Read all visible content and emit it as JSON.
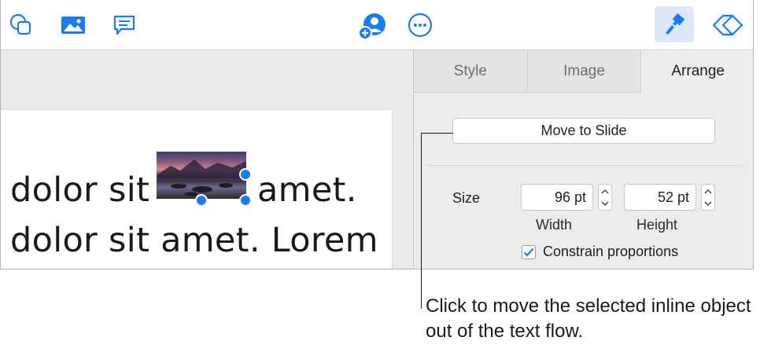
{
  "toolbar": {
    "icons": [
      "shape-icon",
      "media-icon",
      "comment-icon",
      "collaborate-icon",
      "more-icon",
      "format-icon",
      "animate-icon"
    ]
  },
  "slide": {
    "line1_before": "dolor sit",
    "line1_after": "amet.",
    "line2": "dolor sit amet. Lorem"
  },
  "sidebar": {
    "tabs": [
      {
        "label": "Style"
      },
      {
        "label": "Image"
      },
      {
        "label": "Arrange"
      }
    ],
    "active_tab": "Arrange",
    "move_button": "Move to Slide",
    "size_label": "Size",
    "width_value": "96 pt",
    "height_value": "52 pt",
    "width_label": "Width",
    "height_label": "Height",
    "constrain_label": "Constrain proportions",
    "constrain_checked": true
  },
  "callout": {
    "text": "Click to move the selected inline object out of the text flow."
  },
  "colors": {
    "accent": "#1a7cf5",
    "format_active_bg": "#dde9f9"
  }
}
